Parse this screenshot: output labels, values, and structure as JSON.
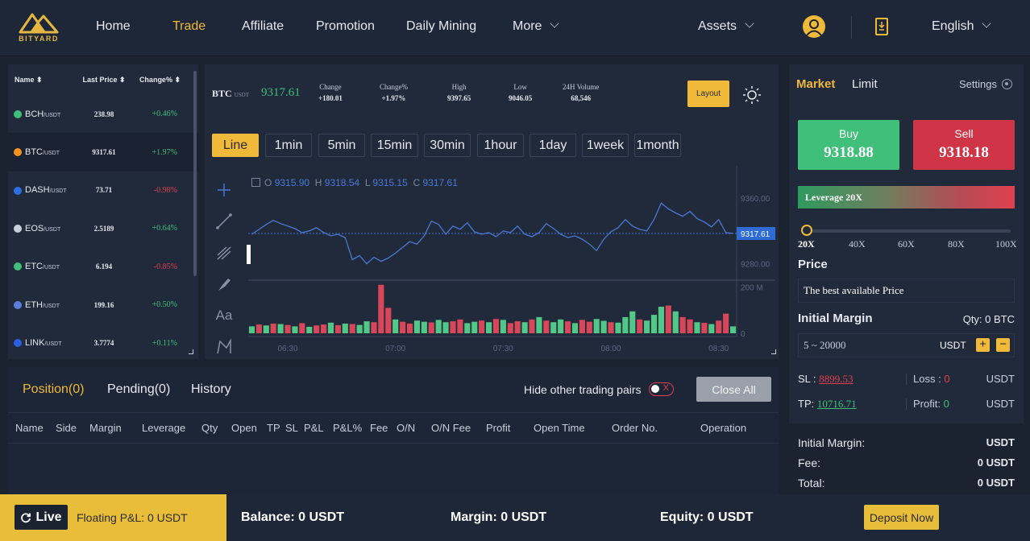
{
  "brand": {
    "logo_text": "BITYARD"
  },
  "nav": {
    "items": [
      "Home",
      "Trade",
      "Affiliate",
      "Promotion",
      "Daily Mining",
      "More"
    ],
    "active": "Trade",
    "assets": "Assets",
    "language": "English"
  },
  "market_list": {
    "headers": {
      "name": "Name",
      "last_price": "Last Price",
      "change": "Change%"
    },
    "rows": [
      {
        "symbol": "BCH",
        "quote": "/USDT",
        "price": "238.98",
        "change": "+0.46%",
        "dir": "up",
        "color": "#3fbf7a"
      },
      {
        "symbol": "BTC",
        "quote": "/USDT",
        "price": "9317.61",
        "change": "+1.97%",
        "dir": "up",
        "color": "#f7931a"
      },
      {
        "symbol": "DASH",
        "quote": "/USDT",
        "price": "73.71",
        "change": "-0.98%",
        "dir": "down",
        "color": "#2b6fe0"
      },
      {
        "symbol": "EOS",
        "quote": "/USDT",
        "price": "2.5189",
        "change": "+0.64%",
        "dir": "up",
        "color": "#c8ceda"
      },
      {
        "symbol": "ETC",
        "quote": "/USDT",
        "price": "6.194",
        "change": "-0.85%",
        "dir": "down",
        "color": "#3fbf7a"
      },
      {
        "symbol": "ETH",
        "quote": "/USDT",
        "price": "199.16",
        "change": "+0.50%",
        "dir": "up",
        "color": "#5a7de0"
      },
      {
        "symbol": "LINK",
        "quote": "/USDT",
        "price": "3.7774",
        "change": "+0.11%",
        "dir": "up",
        "color": "#2b5fe0"
      }
    ],
    "selected": "BTC"
  },
  "ticker": {
    "symbol": "BTC",
    "quote": "USDT",
    "price": "9317.61",
    "stats": [
      {
        "label": "Change",
        "value": "+180.01",
        "dir": "up"
      },
      {
        "label": "Change%",
        "value": "+1.97%",
        "dir": "up"
      },
      {
        "label": "High",
        "value": "9397.65",
        "dir": "none"
      },
      {
        "label": "Low",
        "value": "9046.05",
        "dir": "none"
      },
      {
        "label": "24H Volume",
        "value": "68,546",
        "dir": "none"
      }
    ],
    "layout_label": "Layout"
  },
  "timeframes": {
    "items": [
      "Line",
      "1min",
      "5min",
      "15min",
      "30min",
      "1hour",
      "1day",
      "1week",
      "1month"
    ],
    "active": "Line"
  },
  "chart": {
    "ohlc": {
      "o_label": "O",
      "o": "9315.90",
      "h_label": "H",
      "h": "9318.54",
      "l_label": "L",
      "l": "9315.15",
      "c_label": "C",
      "c": "9317.61"
    },
    "price_ticks": [
      "9360.00",
      "9280.00"
    ],
    "volume_ticks": [
      "200 M",
      "0"
    ],
    "time_ticks": [
      "06:30",
      "07:00",
      "07:30",
      "08:00",
      "08:30"
    ],
    "last_price_label": "9317.61",
    "text_tool_label": "Aa"
  },
  "chart_data": {
    "type": "line",
    "title": "",
    "x": [
      "06:20",
      "06:22",
      "06:24",
      "06:26",
      "06:28",
      "06:30",
      "06:32",
      "06:34",
      "06:36",
      "06:38",
      "06:40",
      "06:42",
      "06:44",
      "06:46",
      "06:48",
      "06:50",
      "06:52",
      "06:54",
      "06:56",
      "06:58",
      "07:00",
      "07:02",
      "07:04",
      "07:06",
      "07:08",
      "07:10",
      "07:12",
      "07:14",
      "07:16",
      "07:18",
      "07:20",
      "07:22",
      "07:24",
      "07:26",
      "07:28",
      "07:30",
      "07:32",
      "07:34",
      "07:36",
      "07:38",
      "07:40",
      "07:42",
      "07:44",
      "07:46",
      "07:48",
      "07:50",
      "07:52",
      "07:54",
      "07:56",
      "07:58",
      "08:00",
      "08:02",
      "08:04",
      "08:06",
      "08:08",
      "08:10",
      "08:12",
      "08:14",
      "08:16",
      "08:18",
      "08:20",
      "08:22",
      "08:24",
      "08:26",
      "08:28",
      "08:30",
      "08:32",
      "08:34"
    ],
    "series": [
      {
        "values": [
          9316,
          9322,
          9328,
          9333,
          9329,
          9326,
          9323,
          9318,
          9320,
          9324,
          9318,
          9314,
          9316,
          9312,
          9285,
          9290,
          9280,
          9288,
          9283,
          9287,
          9293,
          9300,
          9307,
          9304,
          9314,
          9332,
          9328,
          9316,
          9326,
          9322,
          9330,
          9319,
          9316,
          9318,
          9313,
          9320,
          9318,
          9326,
          9316,
          9313,
          9318,
          9329,
          9323,
          9316,
          9312,
          9314,
          9310,
          9304,
          9296,
          9310,
          9319,
          9324,
          9334,
          9326,
          9322,
          9320,
          9334,
          9354,
          9347,
          9342,
          9338,
          9344,
          9335,
          9331,
          9325,
          9334,
          9318,
          9317
        ],
        "color": "#4a79d4"
      },
      {
        "type": "bar",
        "values": [
          30,
          38,
          34,
          42,
          40,
          36,
          30,
          44,
          28,
          34,
          38,
          46,
          35,
          42,
          40,
          36,
          52,
          48,
          210,
          110,
          60,
          50,
          42,
          55,
          50,
          47,
          58,
          48,
          52,
          60,
          44,
          50,
          55,
          48,
          62,
          58,
          44,
          52,
          48,
          60,
          70,
          55,
          48,
          60,
          52,
          44,
          58,
          50,
          62,
          54,
          48,
          46,
          70,
          95,
          60,
          55,
          80,
          115,
          120,
          95,
          70,
          60,
          48,
          45,
          40,
          55,
          85,
          30
        ],
        "colors": [
          "g",
          "r",
          "g",
          "r",
          "g",
          "r",
          "g",
          "r",
          "g",
          "r",
          "r",
          "g",
          "r",
          "g",
          "r",
          "g",
          "g",
          "r",
          "r",
          "r",
          "g",
          "r",
          "r",
          "g",
          "g",
          "r",
          "g",
          "g",
          "r",
          "r",
          "g",
          "g",
          "r",
          "g",
          "r",
          "g",
          "r",
          "r",
          "g",
          "r",
          "g",
          "r",
          "g",
          "g",
          "r",
          "g",
          "r",
          "r",
          "g",
          "g",
          "r",
          "g",
          "g",
          "g",
          "r",
          "g",
          "g",
          "g",
          "r",
          "g",
          "r",
          "r",
          "g",
          "r",
          "g",
          "r",
          "r",
          "g"
        ]
      }
    ],
    "ylim": [
      9260,
      9370
    ],
    "volume_ylim": [
      0,
      230
    ],
    "xlabel": "",
    "ylabel": ""
  },
  "positions": {
    "tabs": [
      "Position(0)",
      "Pending(0)",
      "History"
    ],
    "active_tab": "Position(0)",
    "hide_label": "Hide other trading pairs",
    "toggle_x": "X",
    "close_all": "Close All",
    "columns": [
      "Name",
      "Side",
      "Margin",
      "Leverage",
      "Qty",
      "Open",
      "TP",
      "SL",
      "P&L",
      "P&L%",
      "Fee",
      "O/N",
      "O/N Fee",
      "Profit",
      "Open Time",
      "Order No.",
      "Operation"
    ]
  },
  "order": {
    "tabs": [
      "Market",
      "Limit"
    ],
    "active_tab": "Market",
    "settings": "Settings",
    "buy_label": "Buy",
    "buy_price": "9318.88",
    "sell_label": "Sell",
    "sell_price": "9318.18",
    "leverage_label": "Leverage 20X",
    "leverage_level": 0,
    "leverage_options": [
      "20X",
      "40X",
      "60X",
      "80X",
      "100X"
    ],
    "price_title": "Price",
    "price_value": "The best available Price",
    "margin_title": "Initial Margin",
    "qty_label": "Qty: 0 BTC",
    "margin_placeholder": "5 ~ 20000",
    "margin_unit": "USDT",
    "plus": "+",
    "minus": "−",
    "sl_label": "SL :",
    "sl_value": "8899.53",
    "loss_label": "Loss :",
    "loss_value": "0",
    "tp_label": "TP:",
    "tp_value": "10716.71",
    "profit_label": "Profit:",
    "profit_value": "0",
    "unit": "USDT",
    "summary": [
      {
        "label": "Initial Margin:",
        "value": "USDT"
      },
      {
        "label": "Fee:",
        "value": "0 USDT"
      },
      {
        "label": "Total:",
        "value": "0 USDT"
      }
    ]
  },
  "bottom": {
    "live_label": "Live",
    "floating_pnl": "Floating P&L: 0 USDT",
    "balance": "Balance: 0 USDT",
    "margin": "Margin: 0 USDT",
    "equity": "Equity: 0 USDT",
    "deposit": "Deposit Now"
  },
  "colors": {
    "accent": "#f0b93a",
    "up": "#3fbf7a",
    "down": "#e0404f",
    "line": "#4a79d4"
  }
}
